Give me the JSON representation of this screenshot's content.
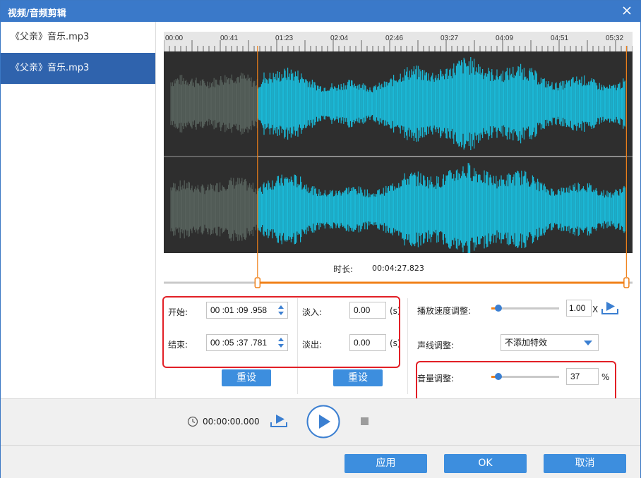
{
  "window": {
    "title": "视频/音频剪辑"
  },
  "sidebar": {
    "items": [
      {
        "label": "《父亲》音乐.mp3",
        "selected": false
      },
      {
        "label": "《父亲》音乐.mp3",
        "selected": true
      }
    ]
  },
  "timeline": {
    "ticks": [
      "00:00",
      "00:41",
      "01:23",
      "02:04",
      "02:46",
      "03:27",
      "04:09",
      "04:51",
      "05:32"
    ],
    "duration_label": "时长:",
    "duration_value": "00:04:27.823",
    "selection_start_fraction": 0.2,
    "selection_end_fraction": 0.987
  },
  "trim": {
    "start_label": "开始:",
    "start_value": "00 :01 :09 .958",
    "end_label": "结束:",
    "end_value": "00 :05 :37 .781",
    "reset_label": "重设"
  },
  "fade": {
    "fade_in_label": "淡入:",
    "fade_in_value": "0.00",
    "fade_out_label": "淡出:",
    "fade_out_value": "0.00",
    "unit": "(s)",
    "reset_label": "重设"
  },
  "effects": {
    "speed_label": "播放速度调整:",
    "speed_value": "1.00",
    "speed_unit": "X",
    "speed_level": 0.1,
    "voice_label": "声线调整:",
    "voice_value": "不添加特效",
    "volume_label": "音量调整:",
    "volume_value": "37",
    "volume_unit": "%",
    "volume_level": 0.1
  },
  "player": {
    "time": "00:00:00.000"
  },
  "footer": {
    "apply_label": "应用",
    "ok_label": "OK",
    "cancel_label": "取消"
  },
  "colors": {
    "accent": "#3d8ede",
    "title_bar": "#3a79c9",
    "waveform": "#1bb8d6",
    "selection": "#f08119",
    "highlight": "#e21f26"
  }
}
